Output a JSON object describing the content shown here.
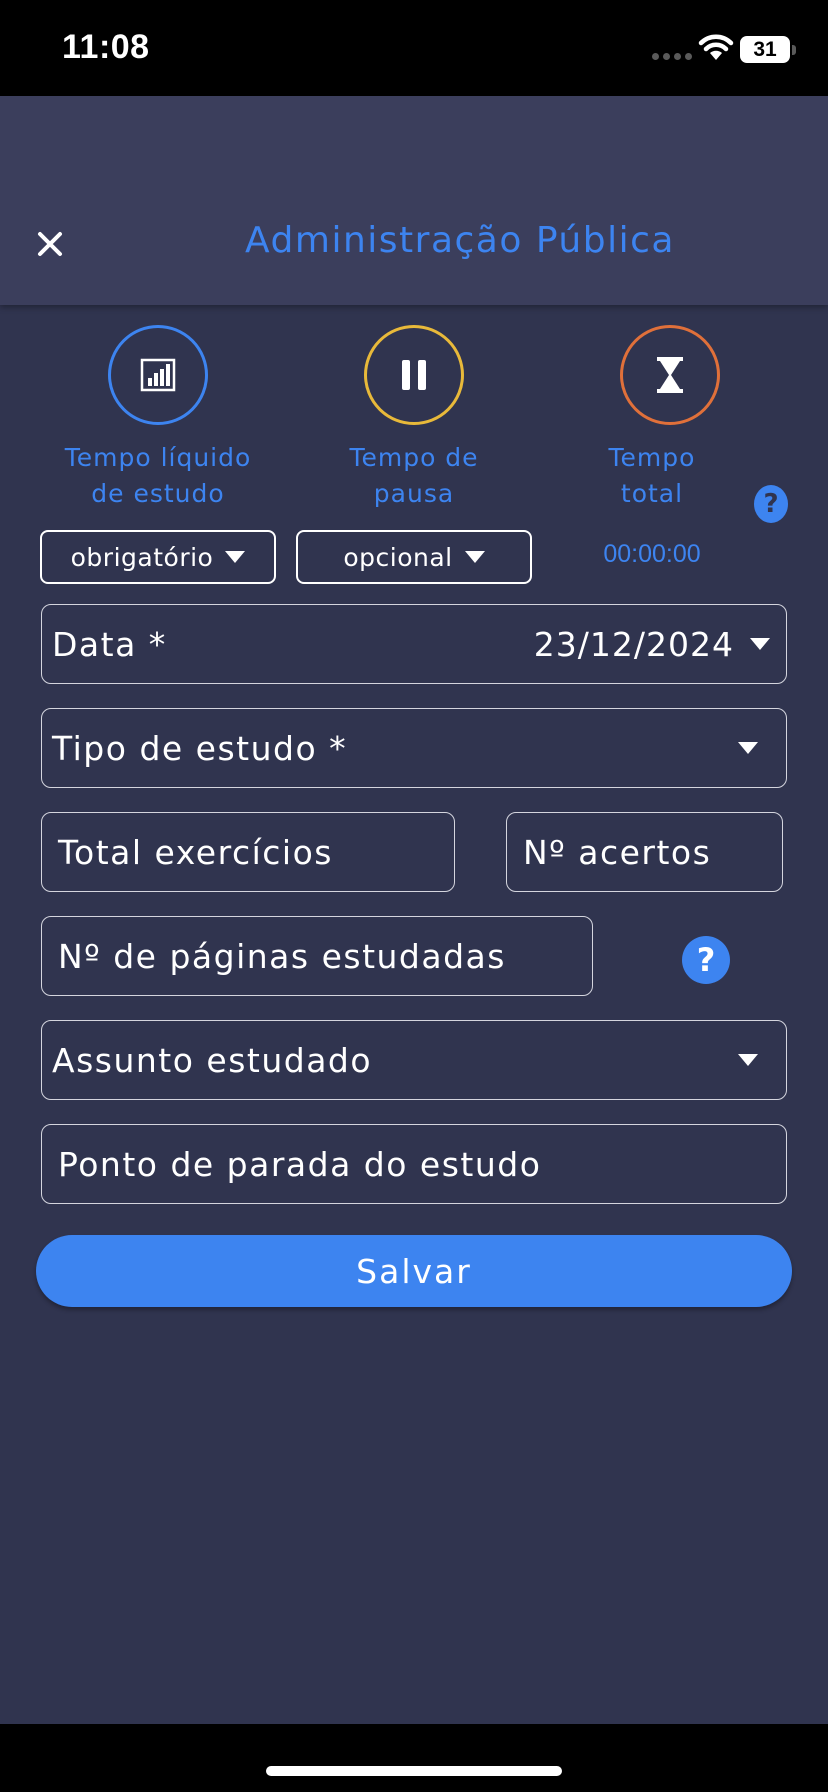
{
  "status_bar": {
    "time": "11:08",
    "battery": "31"
  },
  "header": {
    "title": "Administração Pública"
  },
  "timers": [
    {
      "label_line1": "Tempo líquido",
      "label_line2": "de estudo",
      "color": "#3d84f0"
    },
    {
      "label_line1": "Tempo de",
      "label_line2": "pausa",
      "color": "#e8b93a"
    },
    {
      "label_line1": "Tempo",
      "label_line2": "total",
      "color": "#e0703a"
    }
  ],
  "selects": {
    "first": "obrigatório",
    "second": "opcional"
  },
  "timer_value": "00:00:00",
  "form": {
    "date_label": "Data *",
    "date_value": "23/12/2024",
    "study_type_label": "Tipo de estudo *",
    "total_exercises_placeholder": "Total exercícios",
    "correct_answers_placeholder": "Nº acertos",
    "pages_placeholder": "Nº de páginas estudadas",
    "subject_label": "Assunto estudado",
    "stop_point_placeholder": "Ponto de parada do estudo"
  },
  "help": {
    "glyph": "?"
  },
  "save_label": "Salvar",
  "colors": {
    "accent": "#3d84f0",
    "background": "#30344f",
    "header": "#3b3e5c"
  }
}
